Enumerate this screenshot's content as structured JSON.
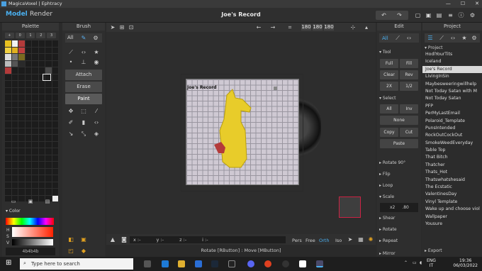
{
  "titlebar": {
    "title": "MagicaVoxel | Ephtracy",
    "min": "—",
    "max": "☐",
    "close": "✕"
  },
  "menubar": {
    "model_tab": "Model",
    "render_tab": "Render",
    "project_title": "Joe's Record"
  },
  "palette": {
    "header": "Palette",
    "tabs": [
      "+",
      "0",
      "1",
      "2",
      "3"
    ]
  },
  "brush": {
    "header": "Brush",
    "all": "All",
    "attach": "Attach",
    "erase": "Erase",
    "paint": "Paint"
  },
  "color": {
    "header": "Color",
    "h": "H",
    "s": "S",
    "v": "V",
    "hex": "4b4b4b"
  },
  "viewport": {
    "coord_x": "180",
    "coord_y": "180",
    "coord_z": "180",
    "readout": {
      "x": "x :-",
      "y": "y :-",
      "z": "z :-",
      "i": "i :-"
    },
    "views": {
      "pers": "Pers",
      "free": "Free",
      "orth": "Orth",
      "iso": "Iso"
    },
    "sign": "Joe's Record"
  },
  "statusbar": {
    "text": "Rotate [RButton] : Move [MButton]"
  },
  "edit": {
    "header": "Edit",
    "all": "All",
    "tool_section": "Tool",
    "tool_buttons": [
      "Full",
      "Fill",
      "Clear",
      "Rev",
      "2X",
      "1/2"
    ],
    "select_section": "Select",
    "select_buttons": [
      "All",
      "Inv",
      "None",
      "Copy",
      "Cut",
      "Paste"
    ],
    "rotate": "Rotate 90°",
    "flip": "Flip",
    "loop": "Loop",
    "scale": "Scale",
    "scale_x": "x2",
    "scale_y": ".80",
    "shear": "Shear",
    "rotate2": "Rotate",
    "repeat": "Repeat",
    "mirror": "Mirror"
  },
  "project": {
    "header": "Project",
    "section": "Project",
    "export": "Export",
    "items": [
      "HodlYourTits",
      "Iceland",
      "Joe's Record",
      "LivingInSin",
      "Maybesweeringwillhelp",
      "Not Today Satan with M",
      "Not Today Satan",
      "PFP",
      "PerMyLastEmail",
      "Polaroid_Template",
      "PunsIntended",
      "RockOutCockOut",
      "SmokeWeedEveryday",
      "Table Top",
      "That Bitch",
      "Thatcher",
      "Thats_Hot",
      "Thatswhatshesaid",
      "The Ecstatic",
      "ValentinesDay",
      "Vinyl Template",
      "Wake up and choose viol",
      "Wallpaper",
      "Yousure"
    ],
    "selected_index": 2
  },
  "taskbar": {
    "search_placeholder": "Type here to search",
    "lang": "ENG",
    "region": "IT",
    "time": "19:36",
    "date": "06/03/2022"
  }
}
